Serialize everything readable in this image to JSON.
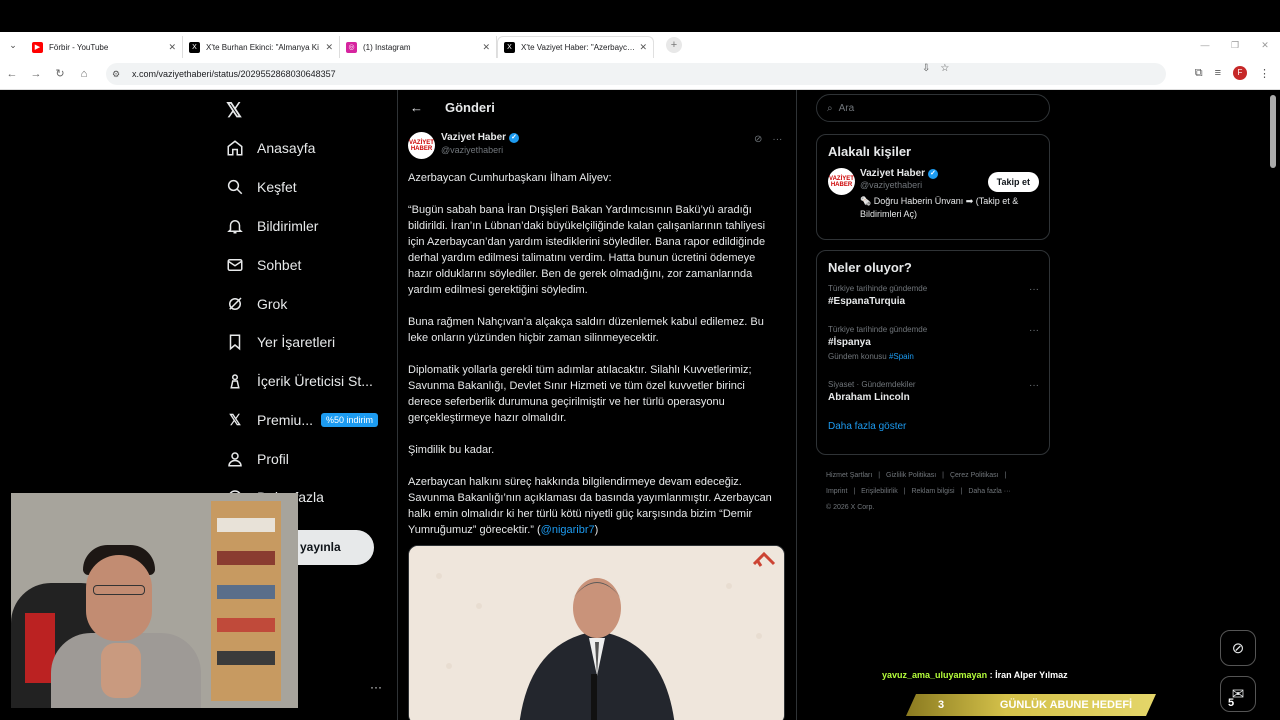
{
  "browser": {
    "tabs": [
      {
        "title": "Förbir - YouTube",
        "icon": "youtube-icon",
        "color": "#ff0000"
      },
      {
        "title": "X'te Burhan Ekinci: \"Almanya Ki",
        "icon": "x-icon",
        "color": "#000000"
      },
      {
        "title": "(1) Instagram",
        "icon": "instagram-icon",
        "color": "#d6249f"
      },
      {
        "title": "X'te Vaziyet Haber: \"Azerbaycan",
        "icon": "x-icon",
        "color": "#000000"
      }
    ],
    "url": "x.com/vaziyethaberi/status/2029552868030648357"
  },
  "leftnav": {
    "items": [
      {
        "label": "Anasayfa",
        "icon": "home-icon"
      },
      {
        "label": "Keşfet",
        "icon": "search-icon"
      },
      {
        "label": "Bildirimler",
        "icon": "bell-icon"
      },
      {
        "label": "Sohbet",
        "icon": "mail-icon"
      },
      {
        "label": "Grok",
        "icon": "grok-icon"
      },
      {
        "label": "Yer İşaretleri",
        "icon": "bookmark-icon"
      },
      {
        "label": "İçerik Üreticisi St...",
        "icon": "creator-icon"
      },
      {
        "label": "Premiu...",
        "icon": "x-premium-icon"
      },
      {
        "label": "Profil",
        "icon": "profile-icon"
      },
      {
        "label": "Daha fazla",
        "icon": "more-icon"
      }
    ],
    "premium_badge": "%50 indirim",
    "post_button": "yayınla"
  },
  "main": {
    "header": "Gönderi",
    "author_name": "Vaziyet Haber",
    "author_handle": "@vaziyethaberi",
    "avatar_text": "VAZİYET HABER",
    "paragraphs": [
      "Azerbaycan Cumhurbaşkanı İlham Aliyev:",
      "“Bugün sabah bana İran Dışişleri Bakan Yardımcısının Bakü’yü aradığı bildirildi. İran’ın Lübnan’daki büyükelçiliğinde kalan çalışanlarının tahliyesi için Azerbaycan’dan yardım istediklerini söylediler. Bana rapor edildiğinde derhal yardım edilmesi talimatını verdim. Hatta bunun ücretini ödemeye hazır olduklarını söylediler. Ben de gerek olmadığını, zor zamanlarında yardım edilmesi gerektiğini söyledim.",
      "Buna rağmen Nahçıvan’a alçakça saldırı düzenlemek kabul edilemez. Bu leke onların yüzünden hiçbir zaman silinmeyecektir.",
      "Diplomatik yollarla gerekli tüm adımlar atılacaktır. Silahlı Kuvvetlerimiz; Savunma Bakanlığı, Devlet Sınır Hizmeti ve tüm özel kuvvetler birinci derece seferberlik durumuna geçirilmiştir ve her türlü operasyonu gerçekleştirmeye hazır olmalıdır.",
      "Şimdilik bu kadar."
    ],
    "last_paragraph": "Azerbaycan halkını süreç hakkında bilgilendirmeye devam edeceğiz. Savunma Bakanlığı’nın açıklaması da basında yayımlanmıştır. Azerbaycan halkı emin olmalıdır ki her türlü kötü niyetli güç karşısında bizim “Demir Yumruğumuz” görecektir.” (",
    "mention": "@nigaribr7",
    "closing": ")"
  },
  "right": {
    "search_placeholder": "Ara",
    "related_title": "Alakalı kişiler",
    "person_name": "Vaziyet Haber",
    "person_handle": "@vaziyethaberi",
    "person_bio": "🗞️ Doğru Haberin Ünvanı ➡ (Takip et & Bildirimleri Aç)",
    "follow_label": "Takip et",
    "trends_title": "Neler oluyor?",
    "trends": [
      {
        "meta": "Türkiye tarihinde gündemde",
        "name": "#EspanaTurquia",
        "sub_prefix": "",
        "sub_link": ""
      },
      {
        "meta": "Türkiye tarihinde gündemde",
        "name": "#İspanya",
        "sub_prefix": "Gündem konusu ",
        "sub_link": "#Spain"
      },
      {
        "meta": "Siyaset · Gündemdekiler",
        "name": "Abraham Lincoln",
        "sub_prefix": "",
        "sub_link": ""
      }
    ],
    "show_more": "Daha fazla göster",
    "footer": [
      "Hizmet Şartları",
      "|",
      "Gizlilik Politikası",
      "|",
      "Çerez Politikası",
      "|",
      "Imprint",
      "|",
      "Erişilebilirlik",
      "|",
      "Reklam bilgisi",
      "|",
      "Daha fazla ···",
      "© 2026 X Corp."
    ]
  },
  "overlay": {
    "chat_user": "yavuz_ama_uluyamayan",
    "chat_sep": " : ",
    "chat_msg": "İran Alper Yılmaz",
    "goal_count": "3",
    "goal_label": "GÜNLÜK ABUNE HEDEFİ",
    "goal_target": "5"
  }
}
